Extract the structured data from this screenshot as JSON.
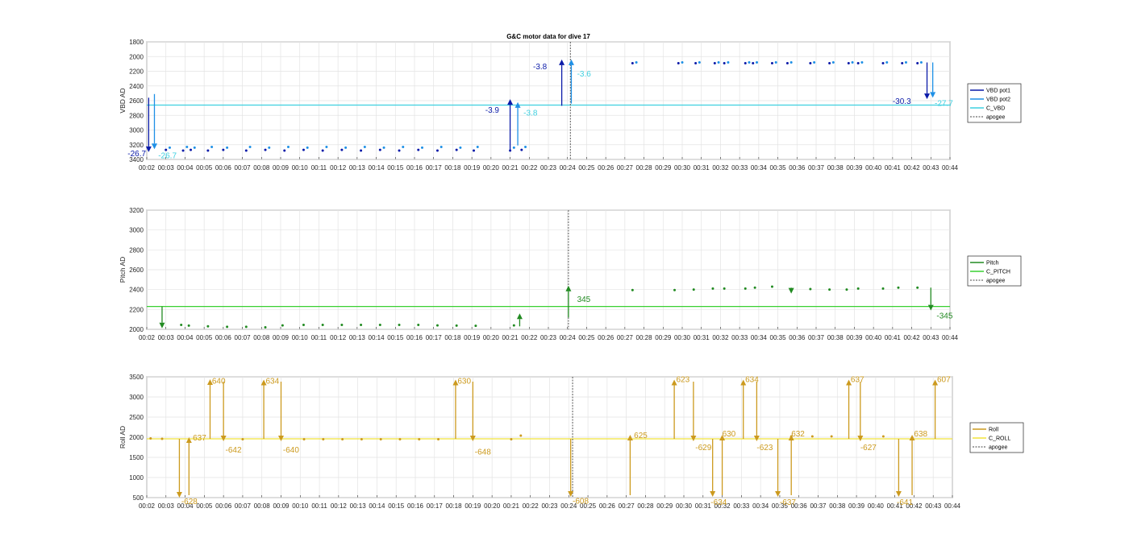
{
  "figure": {
    "title": "G&C motor data for dive 17"
  },
  "x_ticks": [
    "00:02",
    "00:03",
    "00:04",
    "00:05",
    "00:06",
    "00:07",
    "00:08",
    "00:09",
    "00:10",
    "00:11",
    "00:12",
    "00:13",
    "00:14",
    "00:15",
    "00:16",
    "00:17",
    "00:18",
    "00:19",
    "00:20",
    "00:21",
    "00:22",
    "00:23",
    "00:24",
    "00:25",
    "00:26",
    "00:27",
    "00:28",
    "00:29",
    "00:30",
    "00:31",
    "00:32",
    "00:33",
    "00:34",
    "00:35",
    "00:36",
    "00:37",
    "00:38",
    "00:39",
    "00:40",
    "00:41",
    "00:42",
    "00:43",
    "00:44"
  ],
  "colors": {
    "vbd1": "#0a1aa8",
    "vbd2": "#1e90e6",
    "cvbd": "#3fd0e0",
    "pitch": "#228b22",
    "cpitch": "#39d030",
    "roll": "#cc9a1e",
    "croll": "#f2e43a",
    "apogee": "#444444"
  },
  "chart_data": [
    {
      "type": "scatter",
      "ylabel": "VBD AD",
      "ylim": [
        3400,
        1800
      ],
      "y_reversed": true,
      "yticks": [
        1800,
        2000,
        2200,
        2400,
        2600,
        2800,
        3000,
        3200,
        3400
      ],
      "xlim": [
        2,
        44
      ],
      "grid": true,
      "legend_position": "outside-right",
      "legend": [
        "VBD pot1",
        "VBD pot2",
        "C_VBD",
        "apogee"
      ],
      "apogee_x": 24.15,
      "c_line": 2660,
      "series": [
        {
          "name": "VBD pot1",
          "color_key": "vbd1",
          "x": [
            3.0,
            3.9,
            4.3,
            5.2,
            6.0,
            7.2,
            8.2,
            9.2,
            10.2,
            11.2,
            12.2,
            13.2,
            14.2,
            15.2,
            16.2,
            17.2,
            18.2,
            19.1,
            21.0,
            21.6,
            27.4,
            29.8,
            30.7,
            31.7,
            32.2,
            33.3,
            33.7,
            34.7,
            35.5,
            36.7,
            37.7,
            38.7,
            39.2,
            40.5,
            41.5,
            42.3
          ],
          "y": [
            3270,
            3280,
            3270,
            3280,
            3270,
            3280,
            3270,
            3280,
            3270,
            3280,
            3270,
            3280,
            3270,
            3280,
            3270,
            3280,
            3270,
            3280,
            3280,
            3270,
            2090,
            2090,
            2090,
            2090,
            2090,
            2090,
            2090,
            2090,
            2090,
            2090,
            2090,
            2090,
            2090,
            2090,
            2090,
            2090
          ]
        },
        {
          "name": "VBD pot2",
          "color_key": "vbd2",
          "x": [
            3.2,
            4.1,
            4.5,
            5.4,
            6.2,
            7.4,
            8.4,
            9.4,
            10.4,
            11.4,
            12.4,
            13.4,
            14.4,
            15.4,
            16.4,
            17.4,
            18.4,
            19.3,
            21.2,
            21.8,
            27.6,
            30.0,
            30.9,
            31.9,
            32.4,
            33.5,
            33.9,
            34.9,
            35.7,
            36.9,
            37.9,
            38.9,
            39.4,
            40.7,
            41.7,
            42.5
          ],
          "y": [
            3240,
            3230,
            3240,
            3230,
            3240,
            3230,
            3240,
            3230,
            3240,
            3230,
            3240,
            3230,
            3240,
            3230,
            3240,
            3230,
            3240,
            3230,
            3240,
            3230,
            2080,
            2080,
            2080,
            2080,
            2080,
            2080,
            2080,
            2080,
            2080,
            2080,
            2080,
            2080,
            2080,
            2080,
            2080,
            2080
          ]
        }
      ],
      "arrows": [
        {
          "x": 2.1,
          "y0": 2560,
          "y1": 3300,
          "color_key": "vbd1",
          "label": "-26.7",
          "label_color_key": "vbd1",
          "lx": 1.0,
          "ly": 3310
        },
        {
          "x": 2.4,
          "y0": 2510,
          "y1": 3260,
          "color_key": "vbd2",
          "label": "-26.7",
          "label_color_key": "cvbd",
          "lx": 2.6,
          "ly": 3340
        },
        {
          "x": 21.0,
          "y0": 3290,
          "y1": 2580,
          "color_key": "vbd1",
          "label": "-3.9",
          "label_color_key": "vbd1",
          "lx": 19.7,
          "ly": 2720
        },
        {
          "x": 21.4,
          "y0": 3210,
          "y1": 2620,
          "color_key": "vbd2",
          "label": "-3.8",
          "label_color_key": "cvbd",
          "lx": 21.7,
          "ly": 2760
        },
        {
          "x": 23.7,
          "y0": 2670,
          "y1": 2040,
          "color_key": "vbd1",
          "label": "-3.8",
          "label_color_key": "vbd1",
          "lx": 22.2,
          "ly": 2130
        },
        {
          "x": 24.2,
          "y0": 2640,
          "y1": 2040,
          "color_key": "vbd2",
          "label": "-3.6",
          "label_color_key": "cvbd",
          "lx": 24.5,
          "ly": 2230
        },
        {
          "x": 42.8,
          "y0": 2080,
          "y1": 2580,
          "color_key": "vbd1",
          "label": "-30.3",
          "label_color_key": "vbd1",
          "lx": 41.0,
          "ly": 2600
        },
        {
          "x": 43.1,
          "y0": 2080,
          "y1": 2560,
          "color_key": "vbd2",
          "label": "-27.7",
          "label_color_key": "cvbd",
          "lx": 43.2,
          "ly": 2630
        }
      ]
    },
    {
      "type": "scatter",
      "ylabel": "Pitch AD",
      "ylim": [
        2000,
        3200
      ],
      "yticks": [
        2000,
        2200,
        2400,
        2600,
        2800,
        3000,
        3200
      ],
      "xlim": [
        2,
        44
      ],
      "grid": true,
      "legend_position": "outside-right",
      "legend": [
        "Pitch",
        "C_PITCH",
        "apogee"
      ],
      "apogee_x": 24.05,
      "c_line": 2230,
      "series": [
        {
          "name": "Pitch",
          "color_key": "pitch",
          "x": [
            3.8,
            4.2,
            5.2,
            6.2,
            7.2,
            8.2,
            9.1,
            10.2,
            11.2,
            12.2,
            13.2,
            14.2,
            15.2,
            16.2,
            17.2,
            18.2,
            19.2,
            21.2,
            27.4,
            29.6,
            30.6,
            31.6,
            32.2,
            33.3,
            33.8,
            34.7,
            36.7,
            37.7,
            38.6,
            39.2,
            40.5,
            41.3,
            42.3
          ],
          "y": [
            2045,
            2038,
            2030,
            2025,
            2025,
            2020,
            2040,
            2045,
            2045,
            2045,
            2045,
            2045,
            2045,
            2045,
            2040,
            2038,
            2035,
            2040,
            2395,
            2395,
            2400,
            2410,
            2410,
            2410,
            2420,
            2430,
            2405,
            2400,
            2400,
            2410,
            2410,
            2420,
            2420
          ]
        }
      ],
      "arrows": [
        {
          "x": 2.8,
          "y0": 2230,
          "y1": 2010,
          "color_key": "pitch",
          "label": "",
          "label_color_key": "pitch",
          "lx": 0,
          "ly": 0
        },
        {
          "x": 21.5,
          "y0": 2030,
          "y1": 2160,
          "color_key": "pitch",
          "label": "",
          "label_color_key": "pitch",
          "lx": 0,
          "ly": 0
        },
        {
          "x": 24.05,
          "y0": 2120,
          "y1": 2440,
          "color_key": "pitch",
          "label": "345",
          "label_color_key": "pitch",
          "lx": 24.5,
          "ly": 2310
        },
        {
          "x": 35.7,
          "y0": 2420,
          "y1": 2360,
          "color_key": "pitch",
          "label": "",
          "label_color_key": "pitch",
          "lx": 0,
          "ly": 0
        },
        {
          "x": 43.0,
          "y0": 2420,
          "y1": 2190,
          "color_key": "pitch",
          "label": "-345",
          "label_color_key": "pitch",
          "lx": 43.3,
          "ly": 2140
        }
      ]
    },
    {
      "type": "scatter",
      "ylabel": "Roll AD",
      "ylim": [
        500,
        3500
      ],
      "yticks": [
        500,
        1000,
        1500,
        2000,
        2500,
        3000,
        3500
      ],
      "xlim": [
        2,
        44
      ],
      "grid": true,
      "legend_position": "outside-right",
      "legend": [
        "Roll",
        "C_ROLL",
        "apogee"
      ],
      "apogee_x": 24.2,
      "c_line": 1960,
      "series": [
        {
          "name": "Roll",
          "color_key": "roll",
          "x": [
            2.2,
            2.8,
            7.0,
            10.2,
            11.2,
            12.2,
            13.2,
            14.2,
            15.2,
            16.2,
            17.2,
            21.0,
            21.5,
            35.6,
            36.7,
            37.7,
            40.4
          ],
          "y": [
            1970,
            1960,
            1950,
            1950,
            1950,
            1950,
            1950,
            1950,
            1950,
            1950,
            1950,
            1950,
            2040,
            2020,
            2020,
            2020,
            2020
          ]
        }
      ],
      "arrows": [
        {
          "x": 3.7,
          "y0": 1960,
          "y1": 500,
          "color_key": "roll",
          "label": "-628",
          "label_color_key": "roll",
          "lx": 3.8,
          "ly": 420
        },
        {
          "x": 4.2,
          "y0": 560,
          "y1": 2000,
          "color_key": "roll",
          "label": "637",
          "label_color_key": "roll",
          "lx": 4.4,
          "ly": 2000
        },
        {
          "x": 5.3,
          "y0": 1960,
          "y1": 3440,
          "color_key": "roll",
          "label": "640",
          "label_color_key": "roll",
          "lx": 5.4,
          "ly": 3410
        },
        {
          "x": 6.0,
          "y0": 3380,
          "y1": 1900,
          "color_key": "roll",
          "label": "-642",
          "label_color_key": "roll",
          "lx": 6.1,
          "ly": 1700
        },
        {
          "x": 8.1,
          "y0": 1960,
          "y1": 3430,
          "color_key": "roll",
          "label": "634",
          "label_color_key": "roll",
          "lx": 8.2,
          "ly": 3410
        },
        {
          "x": 9.0,
          "y0": 3380,
          "y1": 1900,
          "color_key": "roll",
          "label": "-640",
          "label_color_key": "roll",
          "lx": 9.1,
          "ly": 1700
        },
        {
          "x": 18.1,
          "y0": 1960,
          "y1": 3430,
          "color_key": "roll",
          "label": "630",
          "label_color_key": "roll",
          "lx": 18.2,
          "ly": 3410
        },
        {
          "x": 19.0,
          "y0": 3380,
          "y1": 1900,
          "color_key": "roll",
          "label": "-648",
          "label_color_key": "roll",
          "lx": 19.1,
          "ly": 1650
        },
        {
          "x": 24.1,
          "y0": 1960,
          "y1": 520,
          "color_key": "roll",
          "label": "-608",
          "label_color_key": "roll",
          "lx": 24.2,
          "ly": 430
        },
        {
          "x": 27.2,
          "y0": 560,
          "y1": 2060,
          "color_key": "roll",
          "label": "625",
          "label_color_key": "roll",
          "lx": 27.4,
          "ly": 2060
        },
        {
          "x": 29.5,
          "y0": 1960,
          "y1": 3430,
          "color_key": "roll",
          "label": "623",
          "label_color_key": "roll",
          "lx": 29.6,
          "ly": 3450
        },
        {
          "x": 30.5,
          "y0": 3380,
          "y1": 1900,
          "color_key": "roll",
          "label": "-629",
          "label_color_key": "roll",
          "lx": 30.6,
          "ly": 1760
        },
        {
          "x": 31.5,
          "y0": 1960,
          "y1": 520,
          "color_key": "roll",
          "label": "-634",
          "label_color_key": "roll",
          "lx": 31.4,
          "ly": 400
        },
        {
          "x": 32.0,
          "y0": 560,
          "y1": 2060,
          "color_key": "roll",
          "label": "630",
          "label_color_key": "roll",
          "lx": 32.0,
          "ly": 2100
        },
        {
          "x": 33.1,
          "y0": 1960,
          "y1": 3430,
          "color_key": "roll",
          "label": "634",
          "label_color_key": "roll",
          "lx": 33.2,
          "ly": 3450
        },
        {
          "x": 33.8,
          "y0": 3380,
          "y1": 1900,
          "color_key": "roll",
          "label": "-623",
          "label_color_key": "roll",
          "lx": 33.8,
          "ly": 1760
        },
        {
          "x": 34.9,
          "y0": 1960,
          "y1": 520,
          "color_key": "roll",
          "label": "-637",
          "label_color_key": "roll",
          "lx": 35.0,
          "ly": 400
        },
        {
          "x": 35.6,
          "y0": 560,
          "y1": 2060,
          "color_key": "roll",
          "label": "632",
          "label_color_key": "roll",
          "lx": 35.6,
          "ly": 2100
        },
        {
          "x": 38.6,
          "y0": 1960,
          "y1": 3430,
          "color_key": "roll",
          "label": "637",
          "label_color_key": "roll",
          "lx": 38.7,
          "ly": 3450
        },
        {
          "x": 39.2,
          "y0": 3380,
          "y1": 1900,
          "color_key": "roll",
          "label": "-627",
          "label_color_key": "roll",
          "lx": 39.2,
          "ly": 1760
        },
        {
          "x": 41.2,
          "y0": 1960,
          "y1": 520,
          "color_key": "roll",
          "label": "-641",
          "label_color_key": "roll",
          "lx": 41.1,
          "ly": 400
        },
        {
          "x": 41.9,
          "y0": 560,
          "y1": 2060,
          "color_key": "roll",
          "label": "638",
          "label_color_key": "roll",
          "lx": 42.0,
          "ly": 2100
        },
        {
          "x": 43.1,
          "y0": 1960,
          "y1": 3430,
          "color_key": "roll",
          "label": "607",
          "label_color_key": "roll",
          "lx": 43.2,
          "ly": 3450
        }
      ]
    }
  ]
}
